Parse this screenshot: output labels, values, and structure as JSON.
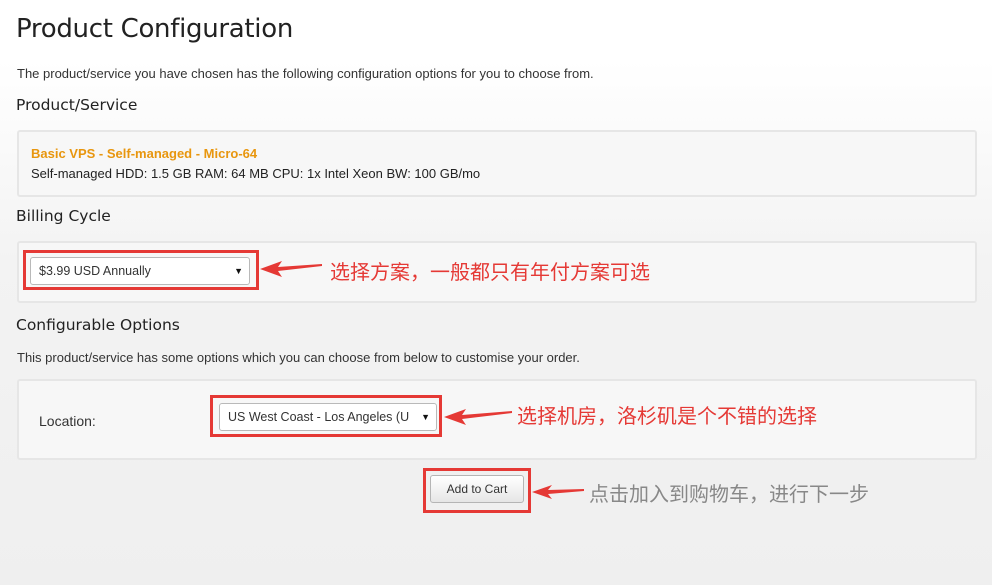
{
  "page": {
    "title": "Product Configuration",
    "intro": "The product/service you have chosen has the following configuration options for you to choose from."
  },
  "product": {
    "heading": "Product/Service",
    "name": "Basic VPS - Self-managed - Micro-64",
    "description": "Self-managed HDD: 1.5 GB RAM: 64 MB CPU: 1x Intel Xeon BW: 100 GB/mo"
  },
  "billing": {
    "heading": "Billing Cycle",
    "selected": "$3.99 USD Annually",
    "annotation": "选择方案，一般都只有年付方案可选"
  },
  "options": {
    "heading": "Configurable Options",
    "intro": "This product/service has some options which you can choose from below to customise your order.",
    "location_label": "Location:",
    "location_selected": "US West Coast - Los Angeles (U",
    "annotation": "选择机房，洛杉矶是个不错的选择"
  },
  "cart": {
    "button_label": "Add to Cart",
    "annotation": "点击加入到购物车，进行下一步"
  },
  "icons": {
    "dropdown": "▼"
  },
  "colors": {
    "accent": "#e8960e",
    "highlight": "#e53935",
    "note_red": "#e53935",
    "note_gray": "#888888"
  }
}
